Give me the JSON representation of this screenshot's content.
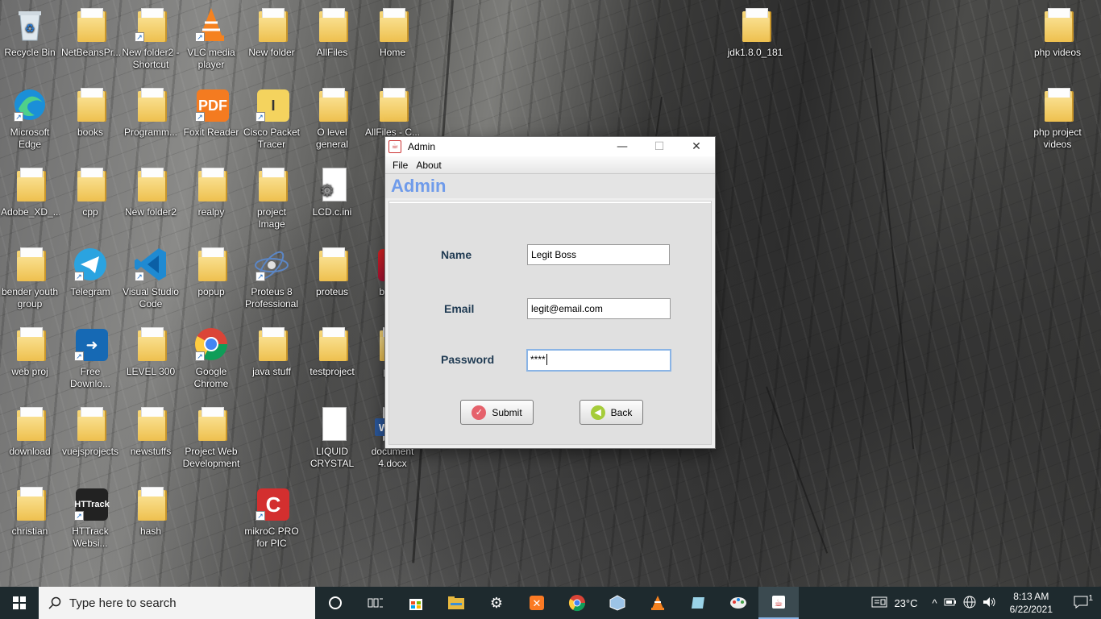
{
  "desktop": {
    "icons": [
      {
        "label": "Recycle Bin",
        "type": "bin"
      },
      {
        "label": "NetBeansPr...",
        "type": "folder"
      },
      {
        "label": "New folder2 - Shortcut",
        "type": "folder"
      },
      {
        "label": "VLC media player",
        "type": "vlc"
      },
      {
        "label": "New folder",
        "type": "folder"
      },
      {
        "label": "AllFiles",
        "type": "folder"
      },
      {
        "label": "Home",
        "type": "folder"
      },
      {
        "label": "jdk1.8.0_181",
        "type": "folder"
      },
      {
        "label": "php videos",
        "type": "folder"
      },
      {
        "label": "Microsoft Edge",
        "type": "edge"
      },
      {
        "label": "books",
        "type": "folder"
      },
      {
        "label": "Programm...",
        "type": "folder"
      },
      {
        "label": "Foxit Reader",
        "type": "foxit"
      },
      {
        "label": "Cisco Packet Tracer Stud...",
        "type": "cisco"
      },
      {
        "label": "O level general",
        "type": "folder"
      },
      {
        "label": "AllFiles - C...",
        "type": "folder"
      },
      {
        "label": "php project videos",
        "type": "folder"
      },
      {
        "label": "Adobe_XD_...",
        "type": "folder"
      },
      {
        "label": "cpp",
        "type": "folder"
      },
      {
        "label": "New folder2",
        "type": "folder"
      },
      {
        "label": "realpy",
        "type": "folder"
      },
      {
        "label": "project Image",
        "type": "folder"
      },
      {
        "label": "LCD.c.ini",
        "type": "ini"
      },
      {
        "label": "bender youth group",
        "type": "folder"
      },
      {
        "label": "Telegram",
        "type": "telegram"
      },
      {
        "label": "Visual Studio Code",
        "type": "vscode"
      },
      {
        "label": "popup",
        "type": "folder"
      },
      {
        "label": "Proteus 8 Professional",
        "type": "proteus"
      },
      {
        "label": "proteus",
        "type": "folder"
      },
      {
        "label": "boot...",
        "type": "winrar"
      },
      {
        "label": "web proj",
        "type": "folder"
      },
      {
        "label": "Free Downlo...",
        "type": "fdm"
      },
      {
        "label": "LEVEL 300",
        "type": "folder"
      },
      {
        "label": "Google Chrome",
        "type": "chrome"
      },
      {
        "label": "java stuff",
        "type": "folder"
      },
      {
        "label": "testproject",
        "type": "folder"
      },
      {
        "label": "ph...",
        "type": "folder"
      },
      {
        "label": "download",
        "type": "folder"
      },
      {
        "label": "vuejsprojects",
        "type": "folder"
      },
      {
        "label": "newstuffs",
        "type": "folder"
      },
      {
        "label": "Project Web Development",
        "type": "folder"
      },
      {
        "label": "LIQUID CRYSTAL DI...",
        "type": "doc"
      },
      {
        "label": "document 4.docx",
        "type": "word"
      },
      {
        "label": "christian",
        "type": "folder"
      },
      {
        "label": "HTTrack Websi...",
        "type": "httrack"
      },
      {
        "label": "hash",
        "type": "folder"
      },
      {
        "label": "mikroC PRO for PIC",
        "type": "mikroc"
      }
    ]
  },
  "window": {
    "title": "Admin",
    "icon": "java-cup-icon",
    "controls": {
      "minimize": "—",
      "maximize": "☐",
      "close": "✕"
    },
    "menu": [
      "File",
      "About"
    ],
    "header": "Admin",
    "form": {
      "name_label": "Name",
      "name_value": "Legit Boss",
      "email_label": "Email",
      "email_value": "legit@email.com",
      "password_label": "Password",
      "password_value": "****",
      "submit_label": "Submit",
      "back_label": "Back"
    }
  },
  "taskbar": {
    "search_placeholder": "Type here to search",
    "weather": "23°C",
    "time": "8:13 AM",
    "date": "6/22/2021",
    "notifications": "1"
  },
  "colors": {
    "accent": "#6f9bea",
    "label": "#1f3a52",
    "taskbar": "#1e2a2e"
  }
}
